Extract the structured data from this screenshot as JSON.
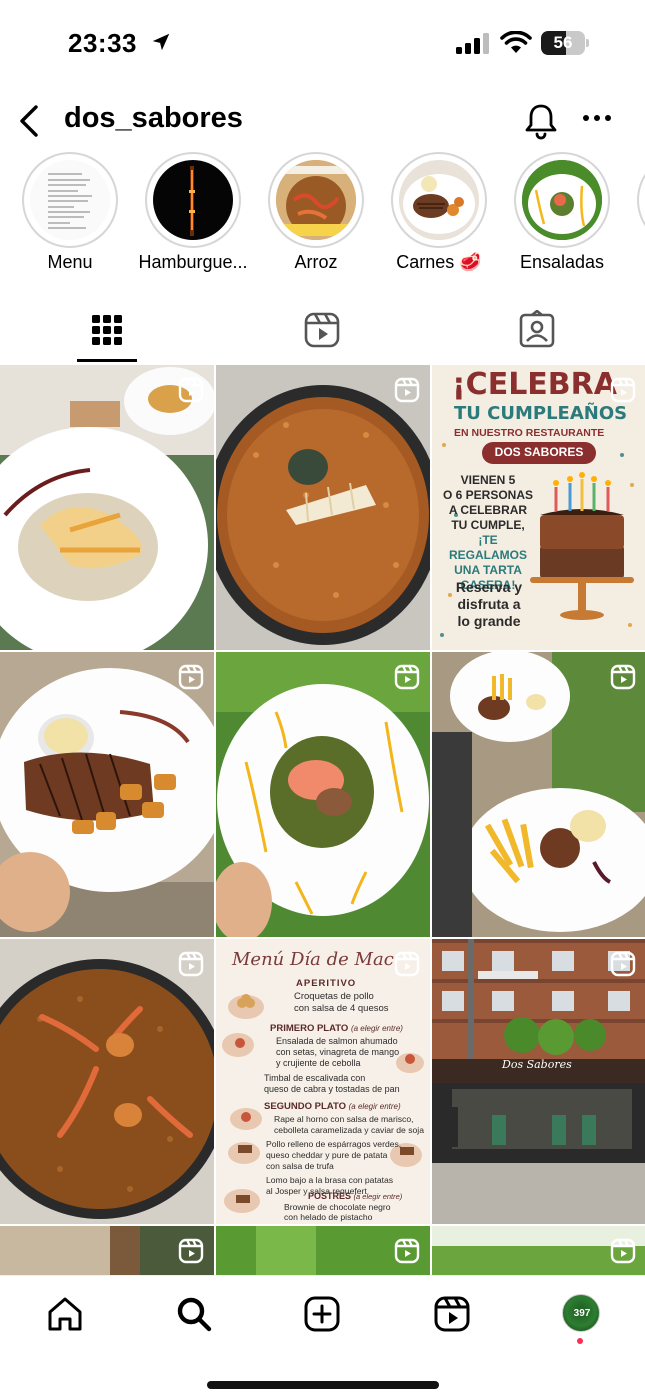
{
  "status_bar": {
    "time": "23:33",
    "battery": "56",
    "battery_level": 0.56
  },
  "header": {
    "username": "dos_sabores"
  },
  "highlights": [
    {
      "label": "Menu"
    },
    {
      "label": "Hamburgue..."
    },
    {
      "label": "Arroz"
    },
    {
      "label": "Carnes 🥩"
    },
    {
      "label": "Ensaladas"
    }
  ],
  "tabs": [
    {
      "icon": "grid-icon",
      "selected": true
    },
    {
      "icon": "reels-icon",
      "selected": false
    },
    {
      "icon": "tagged-icon",
      "selected": false
    }
  ],
  "grid": {
    "posts": [
      {
        "type": "reel",
        "subject": "plated dish with cream sauce"
      },
      {
        "type": "reel",
        "subject": "paella pan with rice"
      },
      {
        "type": "reel",
        "subject": "birthday promotion poster"
      },
      {
        "type": "reel",
        "subject": "grilled steak with potatoes"
      },
      {
        "type": "reel",
        "subject": "salad with salmon"
      },
      {
        "type": "reel",
        "subject": "steak with fries"
      },
      {
        "type": "reel",
        "subject": "seafood rice with shrimp"
      },
      {
        "type": "reel",
        "subject": "menu del dia poster"
      },
      {
        "type": "reel",
        "subject": "restaurant terrace exterior"
      },
      {
        "type": "reel",
        "subject": ""
      },
      {
        "type": "reel",
        "subject": ""
      },
      {
        "type": "reel",
        "subject": ""
      }
    ],
    "poster_celebra": {
      "line1": "¡CELEBRA",
      "line2": "TU CUMPLEAÑOS",
      "line3": "EN NUESTRO RESTAURANTE",
      "badge": "DOS SABORES",
      "body1": "VIENEN 5",
      "body2": "O 6 PERSONAS",
      "body3": "A CELEBRAR",
      "body4": "TU CUMPLE,",
      "body5": "¡TE REGALAMOS",
      "body6": "UNA TARTA",
      "body7": "CASERA!",
      "cta1": "Reserva y",
      "cta2": "disfruta a",
      "cta3": "lo grande"
    },
    "poster_menu": {
      "title": "Menú Día de Mac",
      "s1": "APERITIVO",
      "i1a": "Croquetas de pollo",
      "i1b": "con salsa de 4 quesos",
      "s2": "PRIMERO PLATO",
      "s2n": "(a elegir entre)",
      "i2a": "Ensalada de salmon ahumado",
      "i2b": "con setas, vinagreta de mango",
      "i2c": "y crujiente de cebolla",
      "i3a": "Timbal de escalivada con",
      "i3b": "queso de cabra y tostadas de pan",
      "s3": "SEGUNDO PLATO",
      "s3n": "(a elegir entre)",
      "i4a": "Rape al horno con salsa de marisco,",
      "i4b": "cebolleta caramelizada y caviar de soja",
      "i5a": "Pollo relleno de espárragos verdes,",
      "i5b": "queso cheddar y pure de patata",
      "i5c": "con salsa de trufa",
      "i6a": "Lomo bajo a la brasa con patatas",
      "i6b": "al Josper y salsa requefert",
      "s4": "POSTRES",
      "s4n": "(a elegir entre)",
      "i7a": "Brownie de chocolate negro",
      "i7b": "con helado de pistacho"
    },
    "storefront_sign": "Dos Sabores"
  },
  "bottom_nav": {
    "items": [
      "home-icon",
      "search-icon",
      "create-icon",
      "reels-icon",
      "profile-avatar"
    ],
    "avatar_badge": "397",
    "notification_dot_color": "#ff2d55"
  },
  "colors": {
    "text": "#000000",
    "ring": "#d6d6d6",
    "poster_maroon": "#8b2e2e",
    "poster_teal": "#2c7a7b"
  }
}
